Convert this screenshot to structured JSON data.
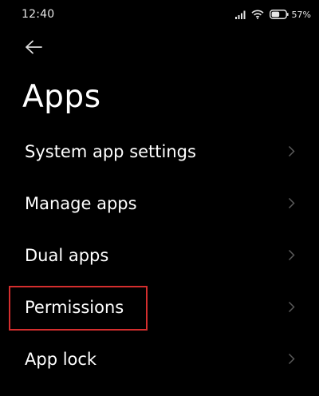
{
  "status_bar": {
    "time": "12:40",
    "battery_level": 57,
    "battery_text": "57%",
    "icons": [
      "signal-icon",
      "wifi-icon",
      "battery-icon"
    ]
  },
  "header": {
    "back_icon": "back-arrow-icon",
    "title": "Apps"
  },
  "list": {
    "items": [
      {
        "label": "System app settings",
        "icon": "chevron-right-icon"
      },
      {
        "label": "Manage apps",
        "icon": "chevron-right-icon"
      },
      {
        "label": "Dual apps",
        "icon": "chevron-right-icon"
      },
      {
        "label": "Permissions",
        "icon": "chevron-right-icon",
        "highlighted": true
      },
      {
        "label": "App lock",
        "icon": "chevron-right-icon"
      }
    ]
  },
  "colors": {
    "background": "#000000",
    "text": "#ffffff",
    "chevron": "#5a5a5a",
    "highlight_border": "#d42e2e"
  }
}
